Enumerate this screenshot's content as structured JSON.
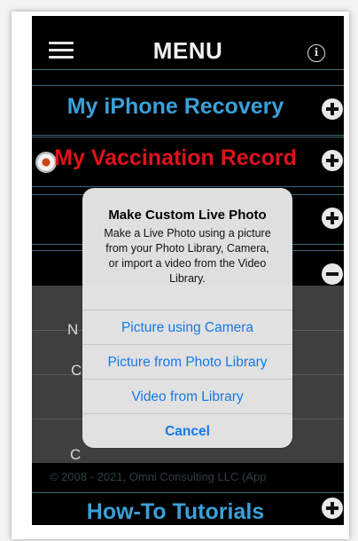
{
  "header": {
    "title": "MENU",
    "menu_icon": "hamburger-icon",
    "info_icon": "info-icon",
    "info_glyph": "i"
  },
  "menu": {
    "items": [
      {
        "label": "My iPhone Recovery",
        "color": "#3aa0d8",
        "toggle": "plus"
      },
      {
        "label": "My Vaccination Record",
        "color": "#e0121a",
        "toggle": "plus"
      },
      {
        "label": "",
        "toggle": "plus"
      },
      {
        "label": "",
        "toggle": "minus"
      },
      {
        "label": "How-To Tutorials",
        "color": "#3aa0d8",
        "toggle": "plus"
      }
    ],
    "peek_letters": [
      "N",
      "C",
      "C"
    ]
  },
  "footer": {
    "copyright": "© 2008 - 2021, Omni Consulting LLC (App"
  },
  "dialog": {
    "title": "Make Custom Live Photo",
    "message": "Make a Live Photo using a picture from your Photo Library, Camera, or import a video from the Video Library.",
    "buttons": {
      "camera": "Picture using Camera",
      "photo_library": "Picture from Photo Library",
      "video_library": "Video from Library",
      "cancel": "Cancel"
    },
    "button_color": "#1778e6"
  }
}
